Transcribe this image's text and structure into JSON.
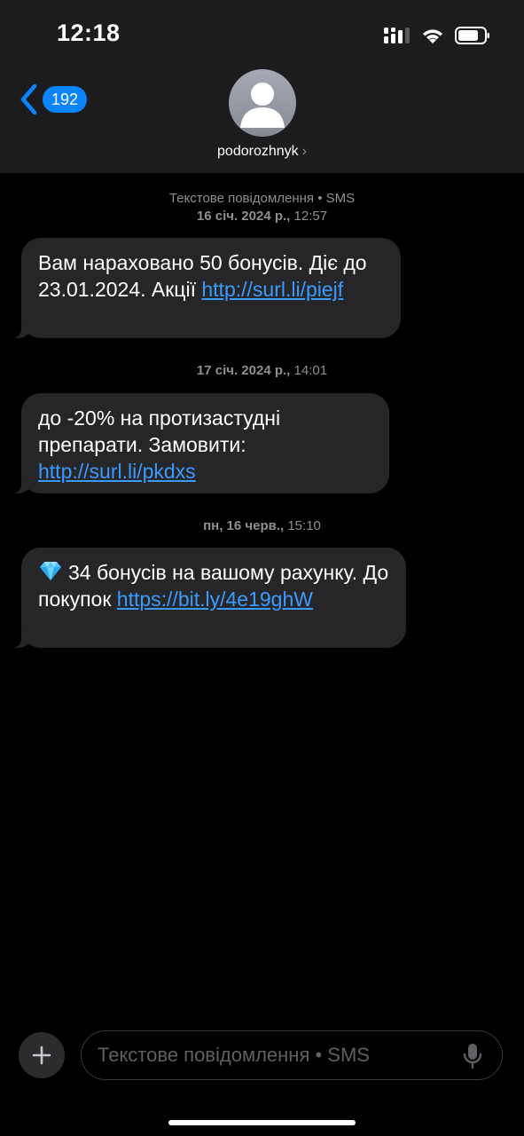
{
  "status_bar": {
    "time": "12:18"
  },
  "header": {
    "back_badge": "192",
    "contact_name": "podorozhnyk",
    "contact_chevron": "›"
  },
  "thread": {
    "service_label": "Текстове повідомлення • SMS",
    "messages": [
      {
        "timestamp_date": "16 січ. 2024 р.,",
        "timestamp_time": "12:57",
        "text": "Вам нараховано 50 бонусів. Діє до 23.01.2024. Акції",
        "link": "http://surl.li/piejf"
      },
      {
        "timestamp_date": "17 січ. 2024 р.,",
        "timestamp_time": "14:01",
        "text": "до -20% на протизастудні препарати. Замовити:",
        "link": "http://surl.li/pkdxs"
      },
      {
        "timestamp_date": "пн, 16 черв.,",
        "timestamp_time": "15:10",
        "text": "34 бонусів на вашому рахунку. До покупок",
        "link": "https://bit.ly/4e19ghW",
        "emoji": "gem-icon"
      }
    ]
  },
  "composer": {
    "placeholder": "Текстове повідомлення • SMS"
  },
  "colors": {
    "accent": "#0a84ff",
    "link": "#3a9bff",
    "bubble": "#262629",
    "header_bg": "#1c1c1e"
  }
}
